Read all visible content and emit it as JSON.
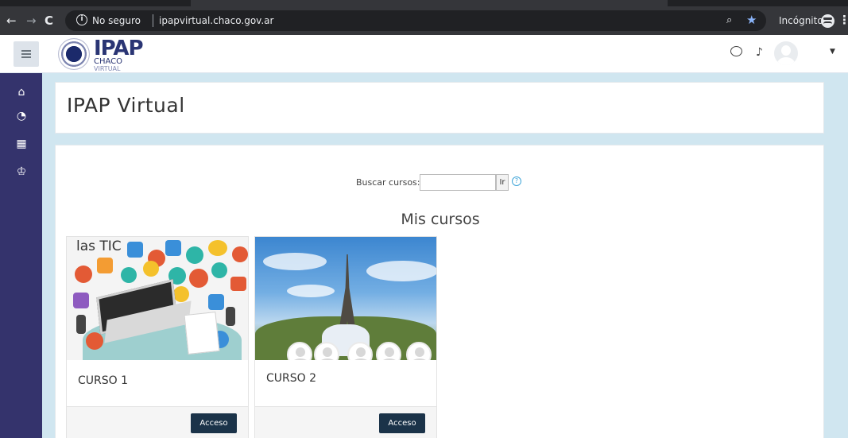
{
  "browser": {
    "insecure_label": "No seguro",
    "url": "ipapvirtual.chaco.gov.ar",
    "incognito_label": "Incógnito"
  },
  "navbar": {
    "logo_main": "IPAP",
    "logo_sub1": "CHACO",
    "logo_sub2": "VIRTUAL"
  },
  "header": {
    "title": "IPAP Virtual"
  },
  "search": {
    "label": "Buscar cursos:",
    "value": "",
    "button_label": "Ir",
    "help": "?"
  },
  "main": {
    "section_title": "Mis cursos",
    "courses": [
      {
        "name": "CURSO 1",
        "button_label": "Acceso",
        "image_text": "las TIC"
      },
      {
        "name": "CURSO 2",
        "button_label": "Acceso"
      }
    ]
  },
  "colors": {
    "drawer": "#34336c",
    "page_bg": "#d0e6f0",
    "access_button": "#1b3349",
    "help_icon": "#3fa5d8"
  }
}
